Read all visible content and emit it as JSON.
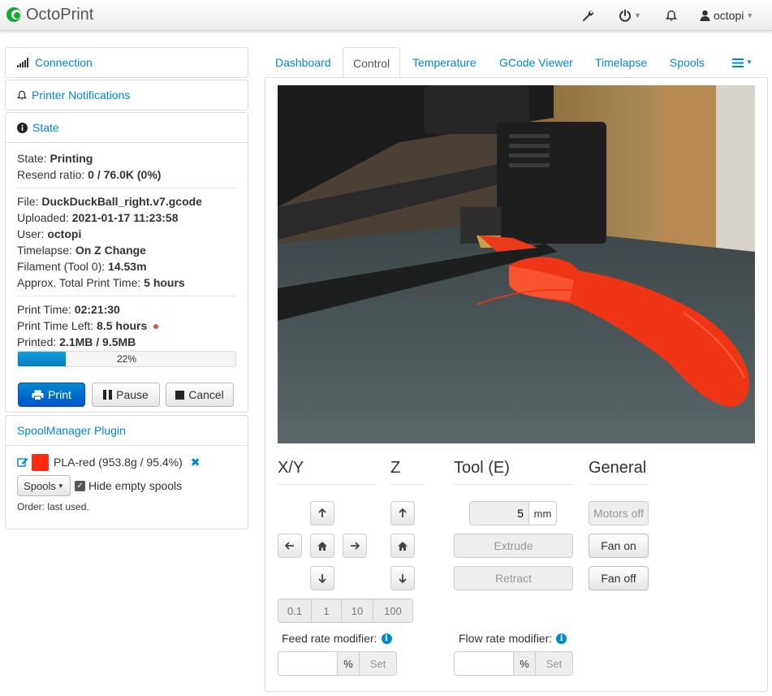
{
  "app": {
    "title": "OctoPrint"
  },
  "navbar": {
    "user": "octopi"
  },
  "sidebar": {
    "connection": {
      "label": "Connection"
    },
    "notifications": {
      "label": "Printer Notifications"
    },
    "state": {
      "label": "State",
      "rows_a": [
        {
          "label": "State: ",
          "value": "Printing"
        },
        {
          "label": "Resend ratio: ",
          "value": "0 / 76.0K (0%)"
        }
      ],
      "rows_b": [
        {
          "label": "File: ",
          "value": "DuckDuckBall_right.v7.gcode"
        },
        {
          "label": "Uploaded: ",
          "value": "2021-01-17 11:23:58"
        },
        {
          "label": "User: ",
          "value": "octopi"
        },
        {
          "label": "Timelapse: ",
          "value": "On Z Change"
        },
        {
          "label": "Filament (Tool 0): ",
          "value": "14.53m"
        },
        {
          "label": "Approx. Total Print Time: ",
          "value": "5 hours"
        }
      ],
      "rows_c": [
        {
          "label": "Print Time: ",
          "value": "02:21:30"
        },
        {
          "label": "Print Time Left: ",
          "value": "8.5 hours"
        },
        {
          "label": "Printed: ",
          "value": "2.1MB / 9.5MB"
        }
      ],
      "progress": {
        "fraction": 0.22,
        "label": "22%"
      },
      "buttons": {
        "print": "Print",
        "pause": "Pause",
        "cancel": "Cancel"
      }
    },
    "spool": {
      "label": "SpoolManager Plugin",
      "spool_name": "PLA-red (953.8g / 95.4%)",
      "spool_color": "#ff2a10",
      "spools_button": "Spools",
      "hide_empty": "Hide empty spools",
      "order": "Order: last used."
    }
  },
  "tabs": [
    {
      "label": "Dashboard"
    },
    {
      "label": "Control"
    },
    {
      "label": "Temperature"
    },
    {
      "label": "GCode Viewer"
    },
    {
      "label": "Timelapse"
    },
    {
      "label": "Spools"
    }
  ],
  "control": {
    "xy_title": "X/Y",
    "z_title": "Z",
    "tool_title": "Tool (E)",
    "general_title": "General",
    "steps": [
      "0.1",
      "1",
      "10",
      "100"
    ],
    "extrude_amount": "5",
    "extrude_unit": "mm",
    "extrude": "Extrude",
    "retract": "Retract",
    "motors_off": "Motors off",
    "fan_on": "Fan on",
    "fan_off": "Fan off",
    "feed_rate_label": "Feed rate modifier:",
    "flow_rate_label": "Flow rate modifier:",
    "percent": "%",
    "set": "Set"
  },
  "colors": {
    "link": "#0088cc",
    "primary": "#0055cc",
    "progress": "#0480be"
  }
}
